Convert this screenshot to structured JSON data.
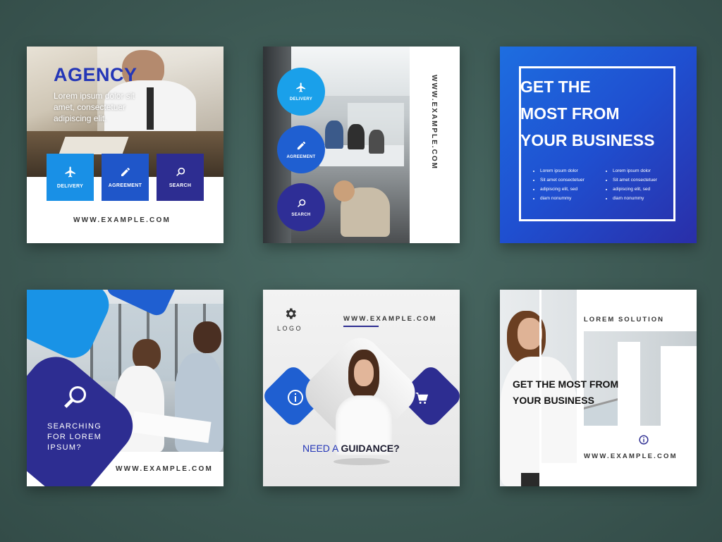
{
  "colors": {
    "accent_blue": "#1b3fbf",
    "light_blue": "#1993e6",
    "navy": "#2d2d91",
    "bg": "#3e5a55"
  },
  "card1": {
    "title": "AGENCY",
    "body": "Lorem ipsum dolor sit amet, consectetuer adipiscing elit.",
    "tiles": [
      {
        "label": "DELIVERY",
        "icon": "plane-icon"
      },
      {
        "label": "AGREEMENT",
        "icon": "pen-icon"
      },
      {
        "label": "SEARCH",
        "icon": "search-icon"
      }
    ],
    "url": "WWW.EXAMPLE.COM"
  },
  "card2": {
    "circles": [
      {
        "label": "DELIVERY",
        "icon": "plane-icon"
      },
      {
        "label": "AGREEMENT",
        "icon": "pen-icon"
      },
      {
        "label": "SEARCH",
        "icon": "search-icon"
      }
    ],
    "url": "WWW.EXAMPLE.COM"
  },
  "card3": {
    "headline": [
      "GET THE",
      "MOST FROM",
      "YOUR BUSINESS"
    ],
    "col1": [
      "Lorem ipsum dolor",
      "Sit amet consectetuer",
      "adipiscing elit, sed",
      "diam nonummy"
    ],
    "col2": [
      "Lorem ipsum dolor",
      "Sit amet consectetuer",
      "adipiscing elit, sed",
      "diam nonummy"
    ]
  },
  "card4": {
    "caption": [
      "SEARCHING",
      "FOR LOREM",
      "IPSUM?"
    ],
    "url": "WWW.EXAMPLE.COM",
    "icon": "search-icon"
  },
  "card5": {
    "logo": "LOGO",
    "url": "WWW.EXAMPLE.COM",
    "tagline_a": "NEED A ",
    "tagline_b": "GUIDANCE?",
    "icons": [
      "info-icon",
      "cart-icon",
      "gear-icon"
    ]
  },
  "card6": {
    "top": "LOREM SOLUTION",
    "headline": [
      "GET THE MOST FROM",
      "YOUR BUSINESS"
    ],
    "url": "WWW.EXAMPLE.COM",
    "icon": "info-icon"
  }
}
